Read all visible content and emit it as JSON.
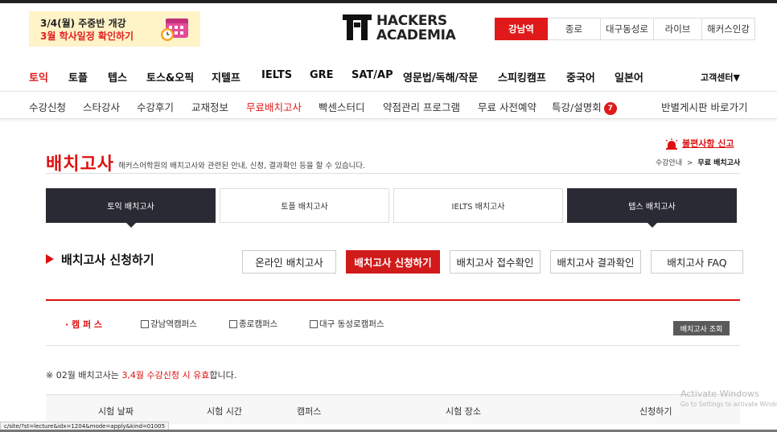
{
  "banner": {
    "line1": "3/4(월) 주중반 개강",
    "line2": "3월 학사일정 확인하기",
    "icon": "calendar-clock-icon"
  },
  "logo": {
    "line1": "HACKERS",
    "line2": "ACADEMIA"
  },
  "campus_tabs": [
    {
      "label": "강남역",
      "active": true
    },
    {
      "label": "종로"
    },
    {
      "label": "대구동성로"
    },
    {
      "label": "라이브"
    },
    {
      "label": "해커스인강"
    }
  ],
  "gnb": {
    "items": [
      "토익",
      "토플",
      "텝스",
      "토스&오픽",
      "지텔프",
      "IELTS",
      "GRE",
      "SAT/AP",
      "영문법/독해/작문",
      "스피킹캠프",
      "중국어",
      "일본어"
    ],
    "customer_center": "고객센터▼"
  },
  "sub_nav": {
    "items": [
      "수강신청",
      "스타강사",
      "수강후기",
      "교재정보",
      "무료배치고사",
      "빡센스터디",
      "약점관리 프로그램",
      "무료 사전예약",
      "특강/설명회"
    ],
    "badge": "7",
    "right_link": "반별게시판 바로가기"
  },
  "page": {
    "title": "배치고사",
    "description": "해커스어학원의 배치고사와 관련된 안내, 신청, 결과확인 등을 할 수 있습니다.",
    "report_link": "불편사항 신고",
    "breadcrumb_parent": "수강안내",
    "breadcrumb_sep": ">",
    "breadcrumb_current": "무료 배치고사"
  },
  "test_tabs": [
    {
      "label": "토익 배치고사",
      "dark": true
    },
    {
      "label": "토플 배치고사"
    },
    {
      "label": "IELTS 배치고사"
    },
    {
      "label": "텝스 배치고사",
      "dark": true
    }
  ],
  "section_title": "배치고사 신청하기",
  "sub_tabs": [
    {
      "label": "온라인 배치고사"
    },
    {
      "label": "배치고사 신청하기",
      "active": true
    },
    {
      "label": "배치고사 접수확인"
    },
    {
      "label": "배치고사 결과확인"
    },
    {
      "label": "배치고사 FAQ"
    }
  ],
  "filter": {
    "label": "· 캠 퍼 스",
    "options": [
      "강남역캠퍼스",
      "종로캠퍼스",
      "대구 동성로캠퍼스"
    ],
    "lookup_button": "배치고사 조회"
  },
  "notice": {
    "prefix": "※ 02월 배치고사는 ",
    "highlight": "3,4월 수강신청 시 유효",
    "suffix": "합니다."
  },
  "table": {
    "headers": [
      "시험 날짜",
      "시험 시간",
      "캠퍼스",
      "시험 장소",
      "신청하기"
    ]
  },
  "status_bar_url": "c/site/?st=lecture&idx=1204&mode=apply&kind=01005",
  "watermark": {
    "line1": "Activate Windows",
    "line2": "Go to Settings to activate Windows."
  },
  "colors": {
    "accent": "#d11a1a",
    "dark_tab": "#2a2a34",
    "banner_bg": "#fff3c8"
  }
}
